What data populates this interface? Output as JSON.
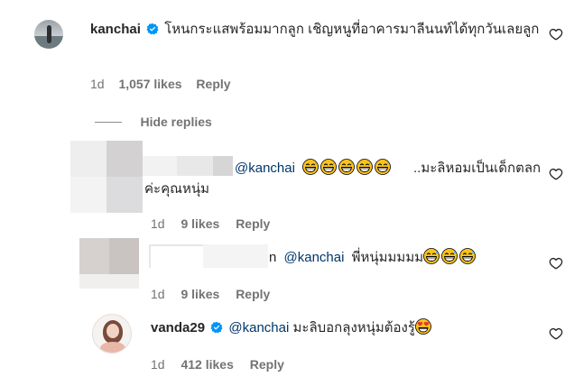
{
  "comment": {
    "username": "kanchai",
    "text": "โหนกระแสพร้อมมากลูก เชิญหนูที่อาคารมาลีนนท์ได้ทุกวันเลยลูก",
    "time": "1d",
    "likes": "1,057 likes",
    "reply_label": "Reply"
  },
  "hide_replies_label": "Hide replies",
  "replies": [
    {
      "mention": "@kanchai",
      "text_after_emojis": "..มะลิหอมเป็นเด็กตลกค่ะคุณหนุ่ม",
      "time": "1d",
      "likes": "9 likes",
      "reply_label": "Reply"
    },
    {
      "mention": "@kanchai",
      "text": "พี่หนุ่มมมมม",
      "time": "1d",
      "likes": "9 likes",
      "reply_label": "Reply"
    },
    {
      "username": "vanda29",
      "mention": "@kanchai",
      "text": "มะลิบอกลุงหนุ่มต้องรู้",
      "time": "1d",
      "likes": "412 likes",
      "reply_label": "Reply"
    }
  ],
  "icons": {
    "heart": "heart-outline-icon",
    "verified": "verified-badge-icon",
    "emoji_grin": "grinning-sweat-emoji",
    "emoji_heart_eyes": "heart-eyes-emoji"
  },
  "colors": {
    "text": "#262626",
    "secondary": "#737373",
    "mention": "#00376b",
    "verified": "#0095f6"
  }
}
